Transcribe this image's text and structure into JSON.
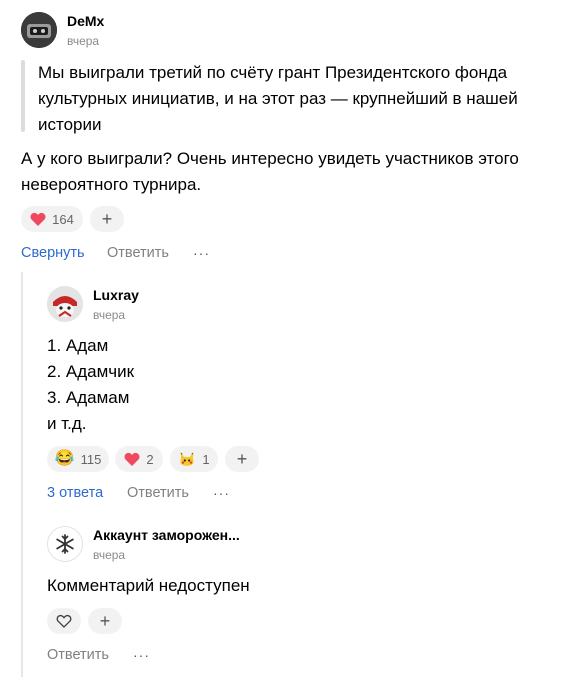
{
  "comment1": {
    "author": "DeMx",
    "time": "вчера",
    "quote": "Мы выиграли третий по счёту грант Президентского фонда культурных инициатив, и на этот раз — крупнейший в нашей истории",
    "text": "А у кого выиграли? Очень интересно увидеть участников этого невероятного турнира.",
    "reactions": [
      {
        "icon": "heart-icon",
        "count": "164"
      }
    ],
    "actions": {
      "collapse": "Свернуть",
      "reply": "Ответить",
      "more": "···"
    }
  },
  "comment2": {
    "author": "Luxray",
    "time": "вчера",
    "lines": [
      "1. Адам",
      "2. Адамчик",
      "3. Адамам",
      "и т.д."
    ],
    "reactions": [
      {
        "icon": "laughing-emoji-icon",
        "emoji": "😂",
        "count": "115"
      },
      {
        "icon": "heart-icon",
        "count": "2"
      },
      {
        "icon": "pikachu-emoji-icon",
        "emoji": "🐱",
        "count": "1"
      }
    ],
    "actions": {
      "replies": "3 ответа",
      "reply": "Ответить",
      "more": "···"
    }
  },
  "comment3": {
    "author": "Аккаунт заморожен...",
    "time": "вчера",
    "text": "Комментарий недоступен",
    "actions": {
      "reply": "Ответить",
      "more": "···"
    }
  },
  "colors": {
    "link": "#2f6ad0",
    "heart": "#f0495f",
    "muted": "#808080"
  }
}
